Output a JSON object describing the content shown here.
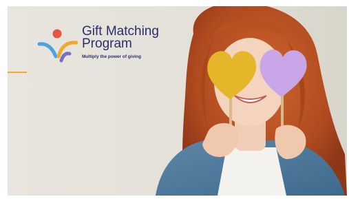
{
  "brand": {
    "title_line1": "Gift Matching",
    "title_line2": "Program",
    "tagline": "Multiply the power of giving",
    "colors": {
      "navy": "#2b2d6e",
      "orange": "#f0a830",
      "red_dot": "#e8553f",
      "blue_arc": "#4aa3df",
      "purple_arc": "#7b6fc4"
    }
  },
  "hero": {
    "heart_left_color": "#e7b92a",
    "heart_right_color": "#c7a5e6",
    "icons": [
      "logo-mark-icon"
    ]
  }
}
